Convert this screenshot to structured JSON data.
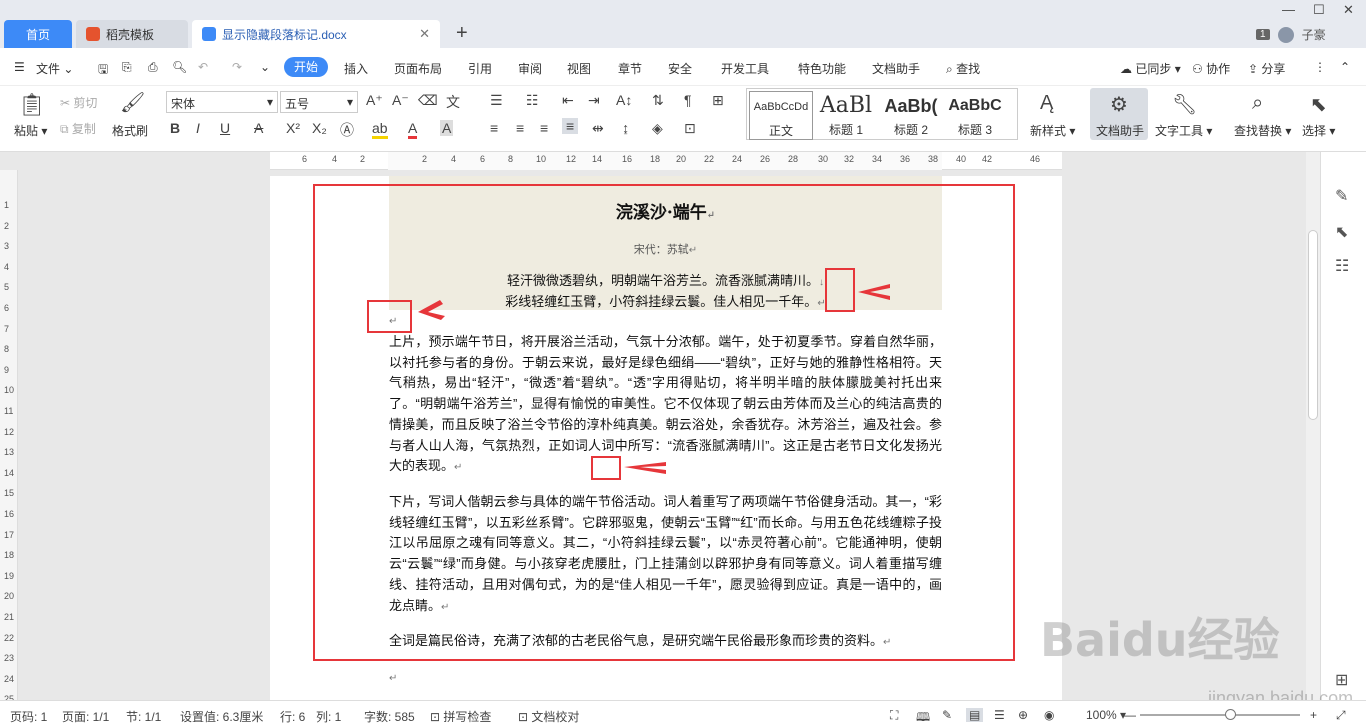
{
  "tabs": {
    "home": "首页",
    "template": "稻壳模板",
    "document": "显示隐藏段落标记.docx"
  },
  "titlebar": {
    "page_badge": "1",
    "user": "子豪"
  },
  "menu": {
    "file": "文件",
    "items": [
      "开始",
      "插入",
      "页面布局",
      "引用",
      "审阅",
      "视图",
      "章节",
      "安全",
      "开发工具",
      "特色功能",
      "文档助手",
      "查找"
    ],
    "synced": "已同步",
    "collab": "协作",
    "share": "分享"
  },
  "ribbon": {
    "paste": "粘贴",
    "cut": "剪切",
    "copy": "复制",
    "format_painter": "格式刷",
    "font_name": "宋体",
    "font_size": "五号",
    "styles": [
      {
        "preview": "AaBbCcDd",
        "label": "正文"
      },
      {
        "preview": "AaBl",
        "label": "标题 1"
      },
      {
        "preview": "AaBb(",
        "label": "标题 2"
      },
      {
        "preview": "AaBbC",
        "label": "标题 3"
      }
    ],
    "new_style": "新样式",
    "doc_assistant": "文档助手",
    "text_tools": "文字工具",
    "find_replace": "查找替换",
    "select": "选择"
  },
  "ruler": {
    "h_ticks": [
      "6",
      "4",
      "2",
      "2",
      "4",
      "6",
      "8",
      "10",
      "12",
      "14",
      "16",
      "18",
      "20",
      "22",
      "24",
      "26",
      "28",
      "30",
      "32",
      "34",
      "36",
      "38",
      "40",
      "42",
      "46"
    ],
    "v_ticks": [
      "1",
      "2",
      "3",
      "4",
      "5",
      "6",
      "7",
      "8",
      "9",
      "10",
      "11",
      "12",
      "13",
      "14",
      "15",
      "16",
      "17",
      "18",
      "19",
      "20",
      "21",
      "22",
      "23",
      "24",
      "25"
    ]
  },
  "document": {
    "title": "浣溪沙·端午",
    "author": "宋代：苏轼",
    "poem": [
      "轻汗微微透碧纨，明朝端午浴芳兰。流香涨腻满晴川。",
      "彩线轻缠红玉臂，小符斜挂绿云鬟。佳人相见一千年。"
    ],
    "p1": "上片，预示端午节日，将开展浴兰活动，气氛十分浓郁。端午，处于初夏季节。穿着自然华丽，以衬托参与者的身份。于朝云来说，最好是绿色细绢——“碧纨”，正好与她的雅静性格相符。天气稍热，易出“轻汗”，“微透”着“碧纨”。“透”字用得贴切，将半明半暗的肤体朦胧美衬托出来了。“明朝端午浴芳兰”，显得有愉悦的审美性。它不仅体现了朝云由芳体而及兰心的纯洁高贵的情操美，而且反映了浴兰令节俗的淳朴纯真美。朝云浴处，余香犹存。沐芳浴兰，遍及社会。参与者人山人海，气氛热烈，正如词人词中所写：“流香涨腻满晴川”。这正是古老节日文化发扬光大的表现。",
    "p2": "下片，写词人偕朝云参与具体的端午节俗活动。词人着重写了两项端午节俗健身活动。其一，“彩线轻缠红玉臂”，以五彩丝系臂”。它辟邪驱鬼，使朝云“玉臂”“红”而长命。与用五色花线缠粽子投江以吊屈原之魂有同等意义。其二，“小符斜挂绿云鬟”，以“赤灵符著心前”。它能通神明，使朝云“云鬟”“绿”而身健。与小孩穿老虎腰肚，门上挂蒲剑以辟邪护身有同等意义。词人着重描写缠线、挂符活动，且用对偶句式，为的是“佳人相见一千年”，愿灵验得到应证。真是一语中的，画龙点睛。",
    "p3": "全词是篇民俗诗，充满了浓郁的古老民俗气息，是研究端午民俗最形象而珍贵的资料。",
    "para_mark": "↵",
    "line_break_mark": "↓"
  },
  "status": {
    "page": "页码: 1",
    "pages": "页面: 1/1",
    "section": "节: 1/1",
    "setting": "设置值: 6.3厘米",
    "row": "行: 6",
    "col": "列: 1",
    "words": "字数: 585",
    "spell": "拼写检查",
    "proof": "文档校对",
    "zoom": "100%",
    "zoom_level": 1.0
  },
  "watermark": {
    "logo": "Baidu经验",
    "url": "jingyan.baidu.com"
  },
  "colors": {
    "accent": "#3d8af7",
    "highlight": "#e6363a",
    "poem_bg": "#efece0"
  }
}
